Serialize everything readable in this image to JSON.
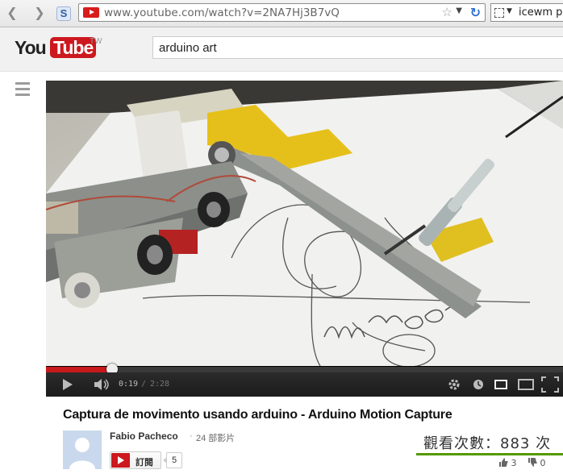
{
  "browser": {
    "url": "www.youtube.com/watch?v=2NA7Hj3B7vQ",
    "search_text": "icewm  p",
    "s_button": "S"
  },
  "header": {
    "logo_you": "You",
    "logo_tube": "Tube",
    "logo_region": "TW",
    "search_value": "arduino art"
  },
  "player": {
    "time_current": "0:19",
    "time_separator": "/",
    "time_duration": "2:28",
    "progress_fraction": 0.128
  },
  "video": {
    "title": "Captura de movimento usando arduino - Arduino Motion Capture",
    "handwriting": "manoo",
    "channel_name": "Fabio Pacheco",
    "channel_dot": "·",
    "video_count": "24 部影片",
    "subscribe_label": "訂閱",
    "subscriber_count": "5",
    "views": "觀看次數：883 次",
    "likes": "3",
    "dislikes": "0"
  },
  "colors": {
    "brand_red": "#cc181e",
    "progress_red": "#c8191b",
    "views_bar": "#559900"
  }
}
